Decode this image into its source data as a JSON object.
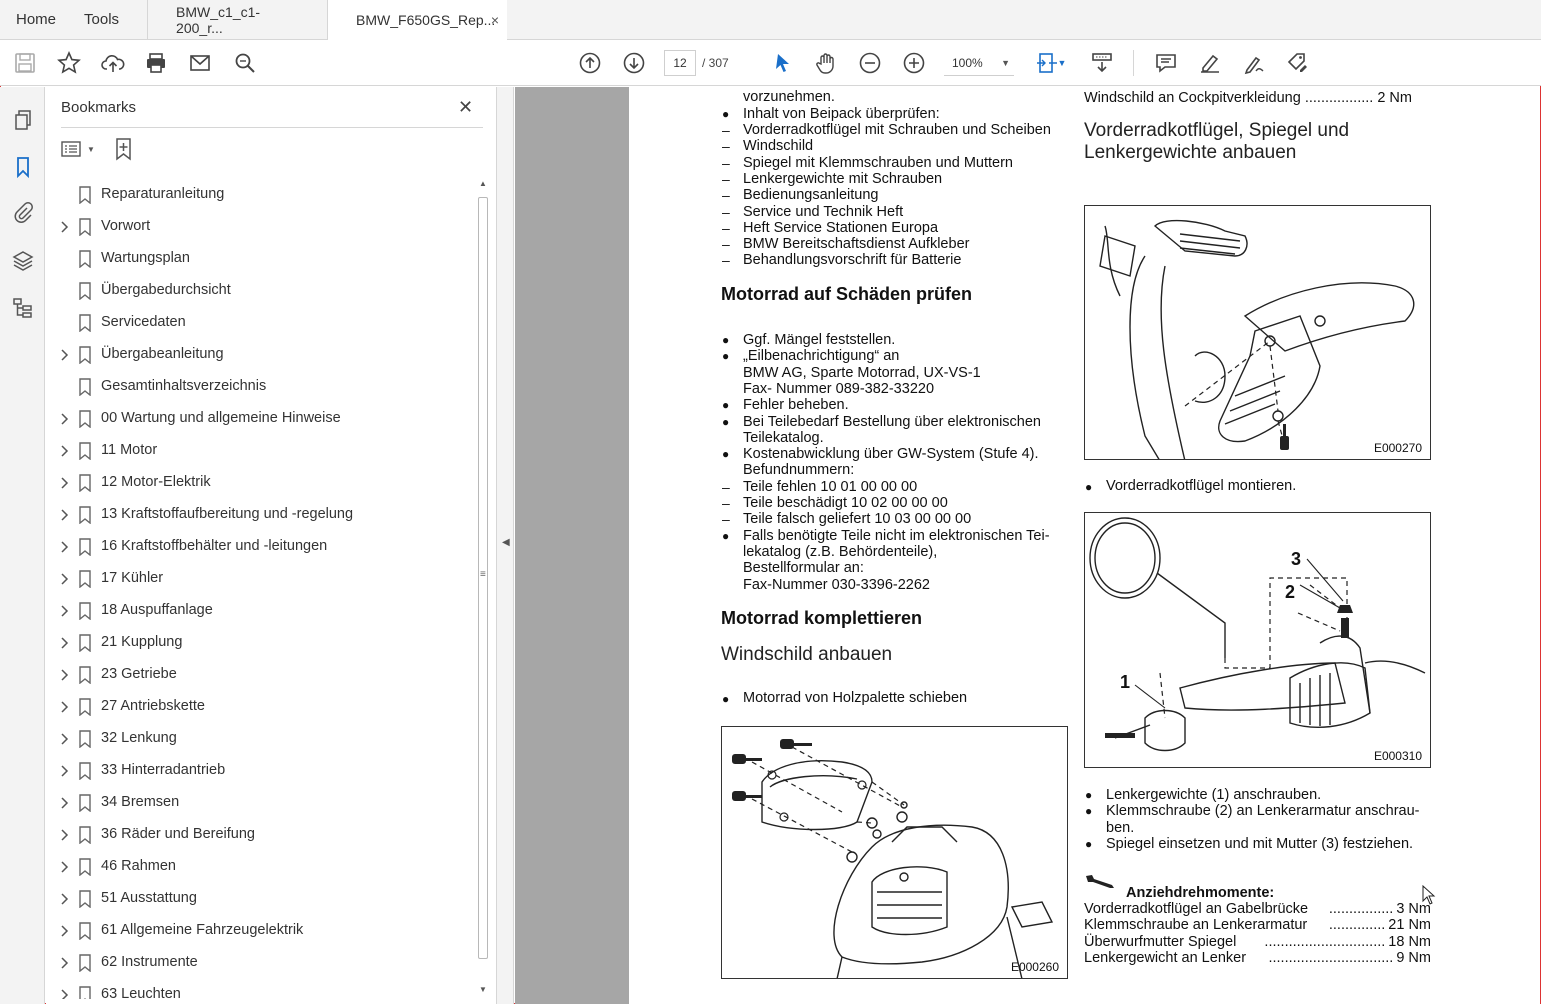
{
  "tabs": {
    "home": "Home",
    "tools": "Tools",
    "doc1": "BMW_c1_c1-200_r...",
    "doc2": "BMW_F650GS_Rep...",
    "close": "×"
  },
  "toolbar": {
    "page_current": "12",
    "page_total": "/ 307",
    "zoom": "100%"
  },
  "bookmarks": {
    "title": "Bookmarks",
    "close": "✕",
    "items": [
      {
        "label": "Reparaturanleitung",
        "expandable": false
      },
      {
        "label": "Vorwort",
        "expandable": true
      },
      {
        "label": "Wartungsplan",
        "expandable": false
      },
      {
        "label": "Übergabedurchsicht",
        "expandable": false
      },
      {
        "label": "Servicedaten",
        "expandable": false
      },
      {
        "label": "Übergabeanleitung",
        "expandable": true
      },
      {
        "label": "Gesamtinhaltsverzeichnis",
        "expandable": false
      },
      {
        "label": "00 Wartung und allgemeine Hinweise",
        "expandable": true
      },
      {
        "label": "11 Motor",
        "expandable": true
      },
      {
        "label": "12 Motor-Elektrik",
        "expandable": true
      },
      {
        "label": "13 Kraftstoffaufbereitung und -regelung",
        "expandable": true
      },
      {
        "label": "16 Kraftstoffbehälter und -leitungen",
        "expandable": true
      },
      {
        "label": "17 Kühler",
        "expandable": true
      },
      {
        "label": "18 Auspuffanlage",
        "expandable": true
      },
      {
        "label": "21 Kupplung",
        "expandable": true
      },
      {
        "label": "23 Getriebe",
        "expandable": true
      },
      {
        "label": "27 Antriebskette",
        "expandable": true
      },
      {
        "label": "32 Lenkung",
        "expandable": true
      },
      {
        "label": "33 Hinterradantrieb",
        "expandable": true
      },
      {
        "label": "34 Bremsen",
        "expandable": true
      },
      {
        "label": "36 Räder und Bereifung",
        "expandable": true
      },
      {
        "label": "46 Rahmen",
        "expandable": true
      },
      {
        "label": "51 Ausstattung",
        "expandable": true
      },
      {
        "label": "61 Allgemeine Fahrzeugelektrik",
        "expandable": true
      },
      {
        "label": "62 Instrumente",
        "expandable": true
      },
      {
        "label": "63 Leuchten",
        "expandable": true
      }
    ]
  },
  "doc": {
    "left_col": {
      "line_top": "vorzunehmen.",
      "beipack_title": "Inhalt von Beipack überprüfen:",
      "beipack_items": [
        "Vorderradkotflügel mit Schrauben und Scheiben",
        "Windschild",
        "Spiegel mit Klemmschrauben und Muttern",
        "Lenkergewichte mit Schrauben",
        "Bedienungsanleitung",
        "Service und Technik Heft",
        "Heft Service Stationen Europa",
        "BMW Bereitschaftsdienst Aufkleber",
        "Behandlungsvorschrift für Batterie"
      ],
      "h_schaeden": "Motorrad auf Schäden prüfen",
      "schaeden_lines": [
        "Ggf. Mängel feststellen.",
        "„Eilbenachrichtigung“ an",
        "BMW AG, Sparte Motorrad, UX-VS-1",
        "Fax- Nummer 089-382-33220",
        "Fehler beheben.",
        "Bei Teilebedarf Bestellung über elektronischen",
        "Teilekatalog.",
        "Kostenabwicklung über GW-System (Stufe 4).",
        "Befundnummern:",
        "Teile fehlen 10 01 00 00 00",
        "Teile beschädigt 10 02 00 00 00",
        "Teile falsch geliefert 10 03 00 00 00",
        "Falls benötigte Teile nicht im elektronischen Tei-",
        "lekatalog (z.B. Behördenteile),",
        "Bestellformular an:",
        "Fax-Nummer 030-3396-2262"
      ],
      "h_komplett": "Motorrad komplettieren",
      "h_windschild": "Windschild anbauen",
      "windschild_step": "Motorrad von Holzpalette schieben",
      "fig_windschild": "E000260"
    },
    "right_col": {
      "torque_top": "Windschild an Cockpitverkleidung ................. 2 Nm",
      "h_spiegel_1": "Vorderradkotflügel, Spiegel und",
      "h_spiegel_2": "Lenkergewichte anbauen",
      "fig_kotfluegel": "E000270",
      "kotfluegel_step": "Vorderradkotflügel montieren.",
      "fig_spiegel": "E000310",
      "fig_labels": [
        "1",
        "2",
        "3"
      ],
      "spiegel_steps": [
        "Lenkergewichte (1) anschrauben.",
        "Klemmschraube (2) an Lenkerarmatur anschrau-",
        "ben.",
        "Spiegel einsetzen und mit Mutter (3) festziehen."
      ],
      "torque_title": "Anziehdrehmomente:",
      "torques": [
        {
          "label": "Vorderradkotflügel an Gabelbrücke",
          "dots": "................",
          "value": "3 Nm"
        },
        {
          "label": "Klemmschraube an Lenkerarmatur",
          "dots": "..............",
          "value": "21 Nm"
        },
        {
          "label": "Überwurfmutter Spiegel",
          "dots": "..............................",
          "value": "18 Nm"
        },
        {
          "label": "Lenkergewicht an Lenker",
          "dots": "...............................",
          "value": "9 Nm"
        }
      ]
    }
  }
}
